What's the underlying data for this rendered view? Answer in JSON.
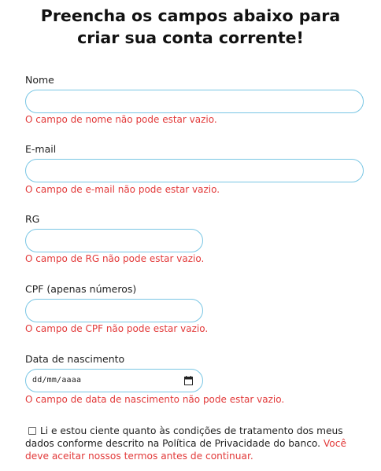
{
  "title_line1": "Preencha os campos abaixo para",
  "title_line2": "criar sua conta corrente!",
  "fields": [
    {
      "label": "Nome",
      "value": "",
      "error": "O campo de nome não pode estar vazio."
    },
    {
      "label": "E-mail",
      "value": "",
      "error": "O campo de e-mail não pode estar vazio."
    },
    {
      "label": "RG",
      "value": "",
      "error": "O campo de RG não pode estar vazio."
    },
    {
      "label": "CPF (apenas números)",
      "value": "",
      "error": "O campo de CPF não pode estar vazio."
    },
    {
      "label": "Data de nascimento",
      "placeholder": "dd/mm/aaaa",
      "error": "O campo de data de nascimento não pode estar vazio."
    }
  ],
  "terms": {
    "checked": false,
    "text": "Li e estou ciente quanto às condições de tratamento dos meus dados conforme descrito na Política de Privacidade do banco.",
    "error": "Você deve aceitar nossos termos antes de continuar."
  },
  "colors": {
    "input_border": "#79c6e4",
    "error": "#e23a3a",
    "text": "#111111"
  },
  "icons": [
    "calendar-icon",
    "checkbox"
  ]
}
